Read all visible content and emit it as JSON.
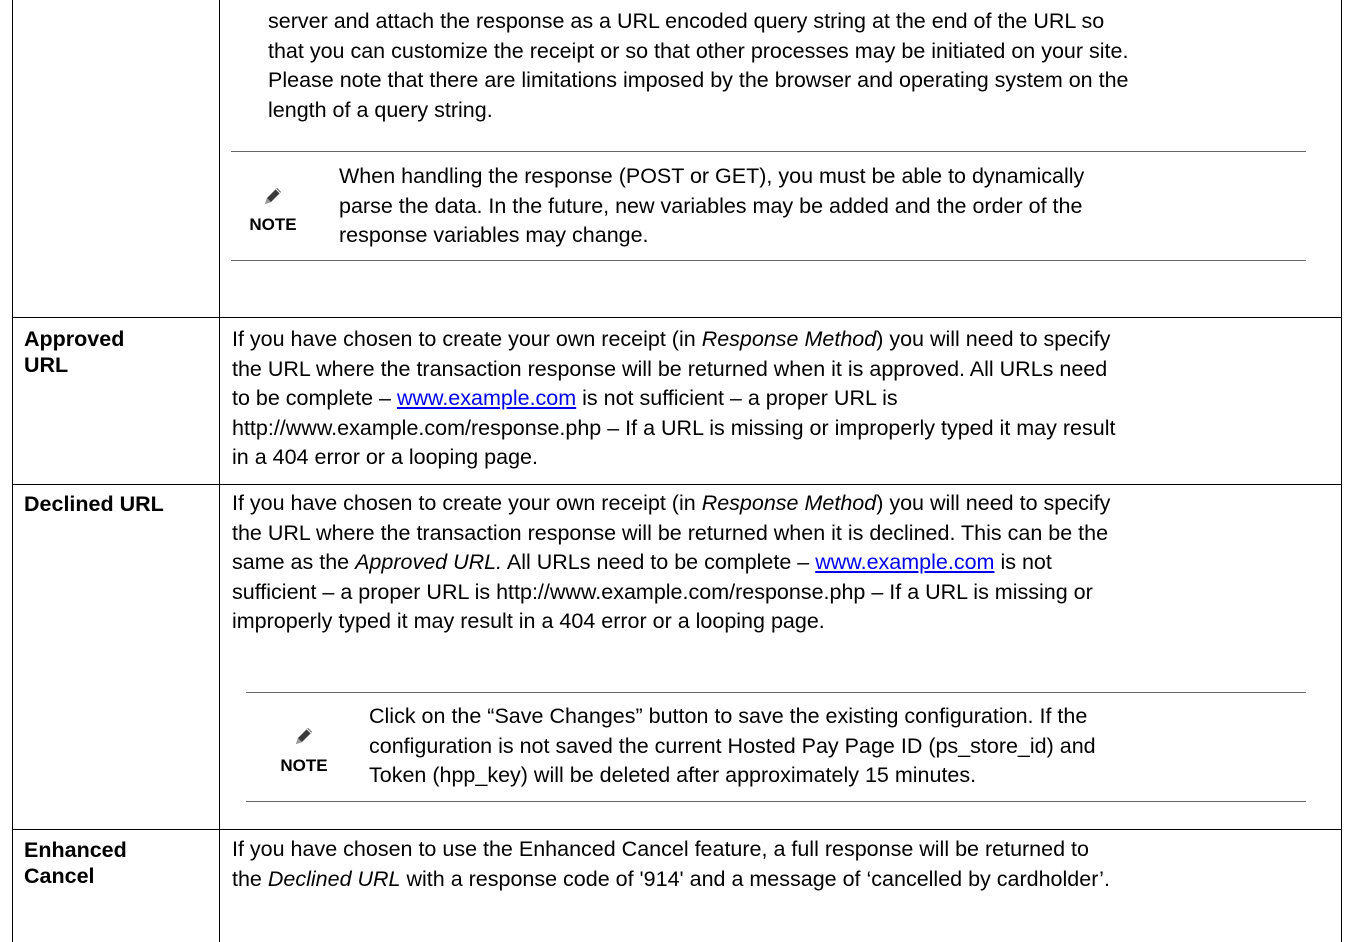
{
  "intro": {
    "line1": "server and attach the response as a URL encoded query string at the end of the URL so",
    "line2": "that you can customize the receipt or so that other processes may be initiated on your site.",
    "line3": "Please note that there are limitations imposed by the browser and operating system on the",
    "line4": "length of a query string."
  },
  "note1": {
    "label": "NOTE",
    "line1": "When handling the response (POST or GET), you must be able to dynamically",
    "line2": "parse the data.  In the future, new variables may be added and the order of the",
    "line3": "response variables may change."
  },
  "approved": {
    "term1": "Approved",
    "term2": "URL",
    "line1_a": "If you have chosen to create your own receipt (in ",
    "line1_em": "Response Method",
    "line1_b": ") you will need to specify",
    "line2": "the URL where the transaction response will be returned when it is approved.  All URLs need",
    "line3_a": "to be complete – ",
    "line3_link": "www.example.com",
    "line3_b": " is not sufficient – a proper URL is",
    "line4": "http://www.example.com/response.php – If a URL is missing or improperly typed it may result",
    "line5": "in a 404 error or a looping page."
  },
  "declined": {
    "term": "Declined URL",
    "line1_a": "If you have chosen to create your own receipt (in ",
    "line1_em": "Response Method",
    "line1_b": ") you will need to specify",
    "line2": "the URL where the transaction response will be returned when it is declined.  This can be the",
    "line3_a": "same as the ",
    "line3_em": "Approved URL.",
    "line3_b": "  All URLs need to be complete – ",
    "line3_link": "www.example.com",
    "line3_c": " is not",
    "line4": "sufficient – a proper URL is http://www.example.com/response.php – If a URL is missing or",
    "line5": "improperly typed it may result in a 404 error or a looping page."
  },
  "note2": {
    "label": "NOTE",
    "line1": "Click on the “Save Changes” button to save the existing configuration.   If the",
    "line2": "configuration is not saved the current Hosted Pay Page ID (ps_store_id) and",
    "line3": "Token (hpp_key) will be deleted after approximately 15 minutes."
  },
  "enhanced": {
    "term1": "Enhanced",
    "term2": "Cancel",
    "line1": "If you have chosen to use the Enhanced Cancel feature, a full response will be returned to",
    "line2_a": "the ",
    "line2_em": "Declined URL",
    "line2_b": " with a response code of '914' and a message of ‘cancelled by cardholder’."
  }
}
